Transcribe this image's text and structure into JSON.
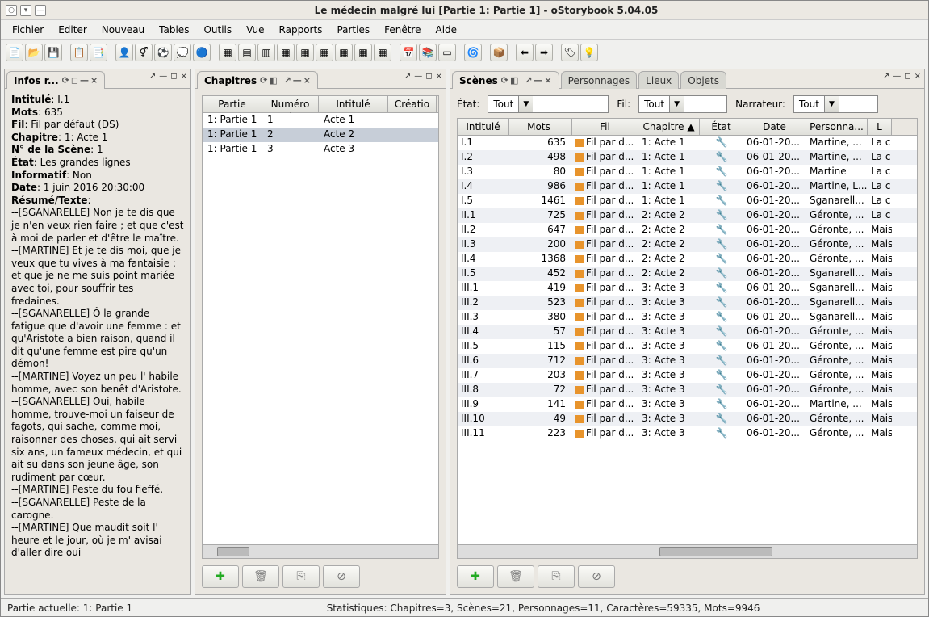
{
  "window": {
    "title": "Le médecin malgré lui [Partie 1: Partie 1] - oStorybook 5.04.05"
  },
  "menu": [
    "Fichier",
    "Editer",
    "Nouveau",
    "Tables",
    "Outils",
    "Vue",
    "Rapports",
    "Parties",
    "Fenêtre",
    "Aide"
  ],
  "panels": {
    "info": {
      "title": "Infos r..."
    },
    "chap": {
      "title": "Chapitres"
    },
    "scenes": {
      "title": "Scènes"
    },
    "extratabs": [
      "Personnages",
      "Lieux",
      "Objets"
    ]
  },
  "filters": {
    "etat_label": "État:",
    "etat_value": "Tout",
    "fil_label": "Fil:",
    "fil_value": "Tout",
    "narr_label": "Narrateur:",
    "narr_value": "Tout"
  },
  "info": {
    "intitule_k": "Intitulé",
    "intitule_v": "I.1",
    "mots_k": "Mots",
    "mots_v": "635",
    "fil_k": "Fil",
    "fil_v": "Fil par défaut (DS)",
    "chapitre_k": "Chapitre",
    "chapitre_v": "1: Acte 1",
    "nscene_k": "N° de la Scène",
    "nscene_v": "1",
    "etat_k": "État",
    "etat_v": "Les grandes lignes",
    "informatif_k": "Informatif",
    "informatif_v": "Non",
    "date_k": "Date",
    "date_v": "1 juin 2016 20:30:00",
    "resume_k": "Résumé/Texte",
    "resume_v": "--[SGANARELLE] Non je te dis que je n'en veux rien faire ; et que c'est à moi de parler et d'être le maître.\n--[MARTINE] Et je te dis moi, que je veux que tu vives à ma fantaisie : et que je ne me suis point mariée avec toi, pour souffrir tes fredaines.\n--[SGANARELLE] Ô la grande fatigue que d'avoir une femme : et qu'Aristote a bien raison, quand il dit qu'une femme est pire qu'un démon!\n--[MARTINE] Voyez un peu l' habile homme, avec son benêt d'Aristote.\n--[SGANARELLE] Oui, habile homme, trouve-moi un faiseur de fagots, qui sache, comme moi, raisonner des choses, qui ait servi six ans, un fameux médecin, et qui ait su dans son jeune âge, son rudiment par cœur.\n--[MARTINE] Peste du fou fieffé.\n--[SGANARELLE] Peste de la carogne.\n--[MARTINE] Que maudit soit l' heure et le jour, où je m' avisai d'aller dire oui"
  },
  "chap_cols": {
    "partie": "Partie",
    "numero": "Numéro ▲",
    "intitule": "Intitulé",
    "creation": "Créatio"
  },
  "chapters": [
    {
      "partie": "1: Partie 1",
      "num": "1",
      "intitule": "Acte 1"
    },
    {
      "partie": "1: Partie 1",
      "num": "2",
      "intitule": "Acte 2"
    },
    {
      "partie": "1: Partie 1",
      "num": "3",
      "intitule": "Acte 3"
    }
  ],
  "scn_cols": {
    "intitule": "Intitulé",
    "mots": "Mots",
    "fil": "Fil",
    "chapitre": "Chapitre ▲",
    "etat": "État",
    "date": "Date",
    "pers": "Personna...",
    "l": "L"
  },
  "scenes": [
    {
      "i": "I.1",
      "m": "635",
      "f": "Fil par d...",
      "c": "1: Acte 1",
      "d": "06-01-20...",
      "p": "Martine, ...",
      "l": "La c"
    },
    {
      "i": "I.2",
      "m": "498",
      "f": "Fil par d...",
      "c": "1: Acte 1",
      "d": "06-01-20...",
      "p": "Martine, ...",
      "l": "La c"
    },
    {
      "i": "I.3",
      "m": "80",
      "f": "Fil par d...",
      "c": "1: Acte 1",
      "d": "06-01-20...",
      "p": "Martine",
      "l": "La c"
    },
    {
      "i": "I.4",
      "m": "986",
      "f": "Fil par d...",
      "c": "1: Acte 1",
      "d": "06-01-20...",
      "p": "Martine, L...",
      "l": "La c"
    },
    {
      "i": "I.5",
      "m": "1461",
      "f": "Fil par d...",
      "c": "1: Acte 1",
      "d": "06-01-20...",
      "p": "Sganarell...",
      "l": "La c"
    },
    {
      "i": "II.1",
      "m": "725",
      "f": "Fil par d...",
      "c": "2: Acte 2",
      "d": "06-01-20...",
      "p": "Géronte, ...",
      "l": "La c"
    },
    {
      "i": "II.2",
      "m": "647",
      "f": "Fil par d...",
      "c": "2: Acte 2",
      "d": "06-01-20...",
      "p": "Géronte, ...",
      "l": "Mais"
    },
    {
      "i": "II.3",
      "m": "200",
      "f": "Fil par d...",
      "c": "2: Acte 2",
      "d": "06-01-20...",
      "p": "Géronte, ...",
      "l": "Mais"
    },
    {
      "i": "II.4",
      "m": "1368",
      "f": "Fil par d...",
      "c": "2: Acte 2",
      "d": "06-01-20...",
      "p": "Géronte, ...",
      "l": "Mais"
    },
    {
      "i": "II.5",
      "m": "452",
      "f": "Fil par d...",
      "c": "2: Acte 2",
      "d": "06-01-20...",
      "p": "Sganarell...",
      "l": "Mais"
    },
    {
      "i": "III.1",
      "m": "419",
      "f": "Fil par d...",
      "c": "3: Acte 3",
      "d": "06-01-20...",
      "p": "Sganarell...",
      "l": "Mais"
    },
    {
      "i": "III.2",
      "m": "523",
      "f": "Fil par d...",
      "c": "3: Acte 3",
      "d": "06-01-20...",
      "p": "Sganarell...",
      "l": "Mais"
    },
    {
      "i": "III.3",
      "m": "380",
      "f": "Fil par d...",
      "c": "3: Acte 3",
      "d": "06-01-20...",
      "p": "Sganarell...",
      "l": "Mais"
    },
    {
      "i": "III.4",
      "m": "57",
      "f": "Fil par d...",
      "c": "3: Acte 3",
      "d": "06-01-20...",
      "p": "Géronte, ...",
      "l": "Mais"
    },
    {
      "i": "III.5",
      "m": "115",
      "f": "Fil par d...",
      "c": "3: Acte 3",
      "d": "06-01-20...",
      "p": "Géronte, ...",
      "l": "Mais"
    },
    {
      "i": "III.6",
      "m": "712",
      "f": "Fil par d...",
      "c": "3: Acte 3",
      "d": "06-01-20...",
      "p": "Géronte, ...",
      "l": "Mais"
    },
    {
      "i": "III.7",
      "m": "203",
      "f": "Fil par d...",
      "c": "3: Acte 3",
      "d": "06-01-20...",
      "p": "Géronte, ...",
      "l": "Mais"
    },
    {
      "i": "III.8",
      "m": "72",
      "f": "Fil par d...",
      "c": "3: Acte 3",
      "d": "06-01-20...",
      "p": "Géronte, ...",
      "l": "Mais"
    },
    {
      "i": "III.9",
      "m": "141",
      "f": "Fil par d...",
      "c": "3: Acte 3",
      "d": "06-01-20...",
      "p": "Martine, ...",
      "l": "Mais"
    },
    {
      "i": "III.10",
      "m": "49",
      "f": "Fil par d...",
      "c": "3: Acte 3",
      "d": "06-01-20...",
      "p": "Géronte, ...",
      "l": "Mais"
    },
    {
      "i": "III.11",
      "m": "223",
      "f": "Fil par d...",
      "c": "3: Acte 3",
      "d": "06-01-20...",
      "p": "Géronte, ...",
      "l": "Mais"
    }
  ],
  "status": {
    "partie": "Partie actuelle: 1: Partie 1",
    "stats": "Statistiques: Chapitres=3,  Scènes=21,  Personnages=11,  Caractères=59335,  Mots=9946"
  }
}
